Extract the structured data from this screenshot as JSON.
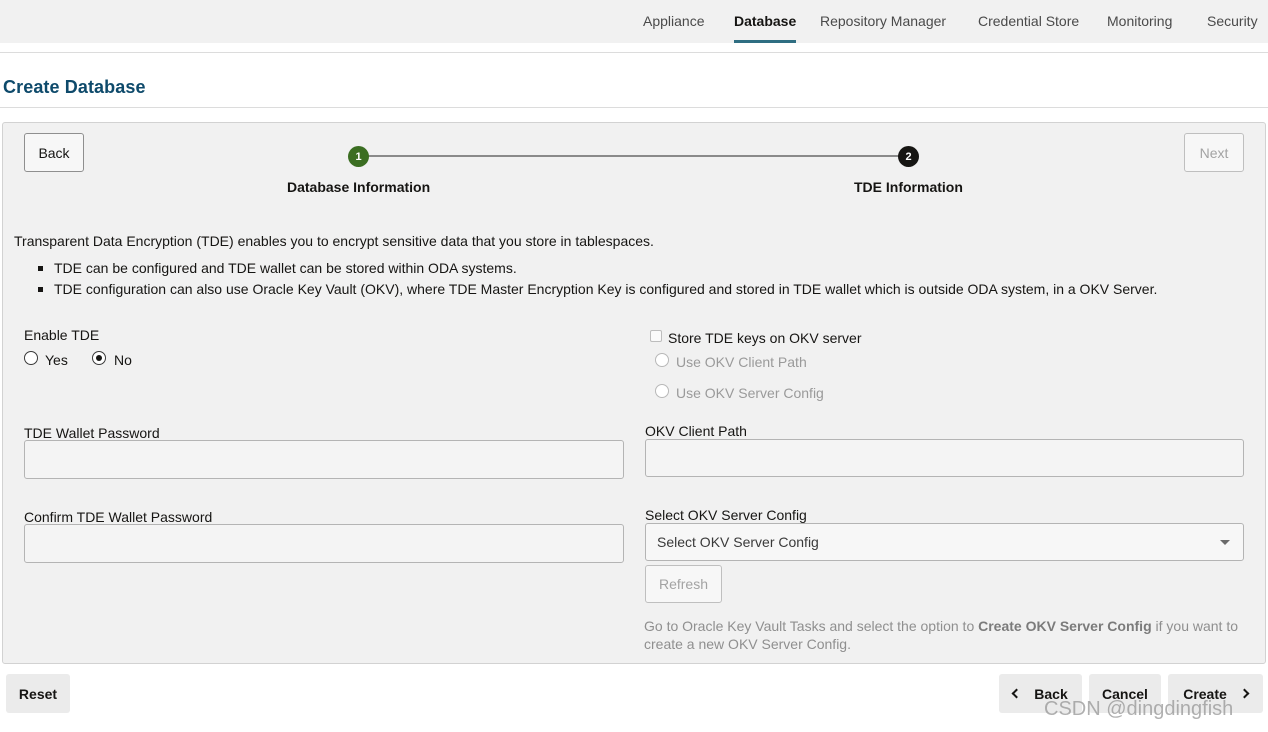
{
  "nav": {
    "tabs": [
      "Appliance",
      "Database",
      "Repository Manager",
      "Credential Store",
      "Monitoring",
      "Security"
    ],
    "active": "Database"
  },
  "page": {
    "title": "Create Database"
  },
  "wizard": {
    "back_label": "Back",
    "next_label": "Next",
    "steps": [
      {
        "number": "1",
        "label": "Database Information"
      },
      {
        "number": "2",
        "label": "TDE Information"
      }
    ]
  },
  "intro": {
    "text": "Transparent Data Encryption (TDE) enables you to encrypt sensitive data that you store in tablespaces.",
    "bullets": [
      "TDE can be configured and TDE wallet can be stored within ODA systems.",
      "TDE configuration can also use Oracle Key Vault (OKV), where TDE Master Encryption Key is configured and stored in TDE wallet which is outside ODA system, in a OKV Server."
    ]
  },
  "form": {
    "enable_tde": {
      "label": "Enable TDE",
      "options": [
        "Yes",
        "No"
      ],
      "selected": "No"
    },
    "store_okv": {
      "label": "Store TDE keys on OKV server",
      "checked": false
    },
    "okv_options": [
      "Use OKV Client Path",
      "Use OKV Server Config"
    ],
    "wallet_password": {
      "label": "TDE Wallet Password",
      "value": ""
    },
    "confirm_password": {
      "label": "Confirm TDE Wallet Password",
      "value": ""
    },
    "okv_client_path": {
      "label": "OKV Client Path",
      "value": ""
    },
    "okv_server_config": {
      "label": "Select OKV Server Config",
      "selected": "Select OKV Server Config"
    },
    "refresh_label": "Refresh",
    "hint": {
      "prefix": "Go to Oracle Key Vault Tasks and select the option to ",
      "bold": "Create OKV Server Config",
      "suffix": " if you want to create a new OKV Server Config."
    }
  },
  "footer": {
    "reset_label": "Reset",
    "back_label": "Back",
    "cancel_label": "Cancel",
    "create_label": "Create"
  },
  "watermark": "CSDN @dingdingfish"
}
